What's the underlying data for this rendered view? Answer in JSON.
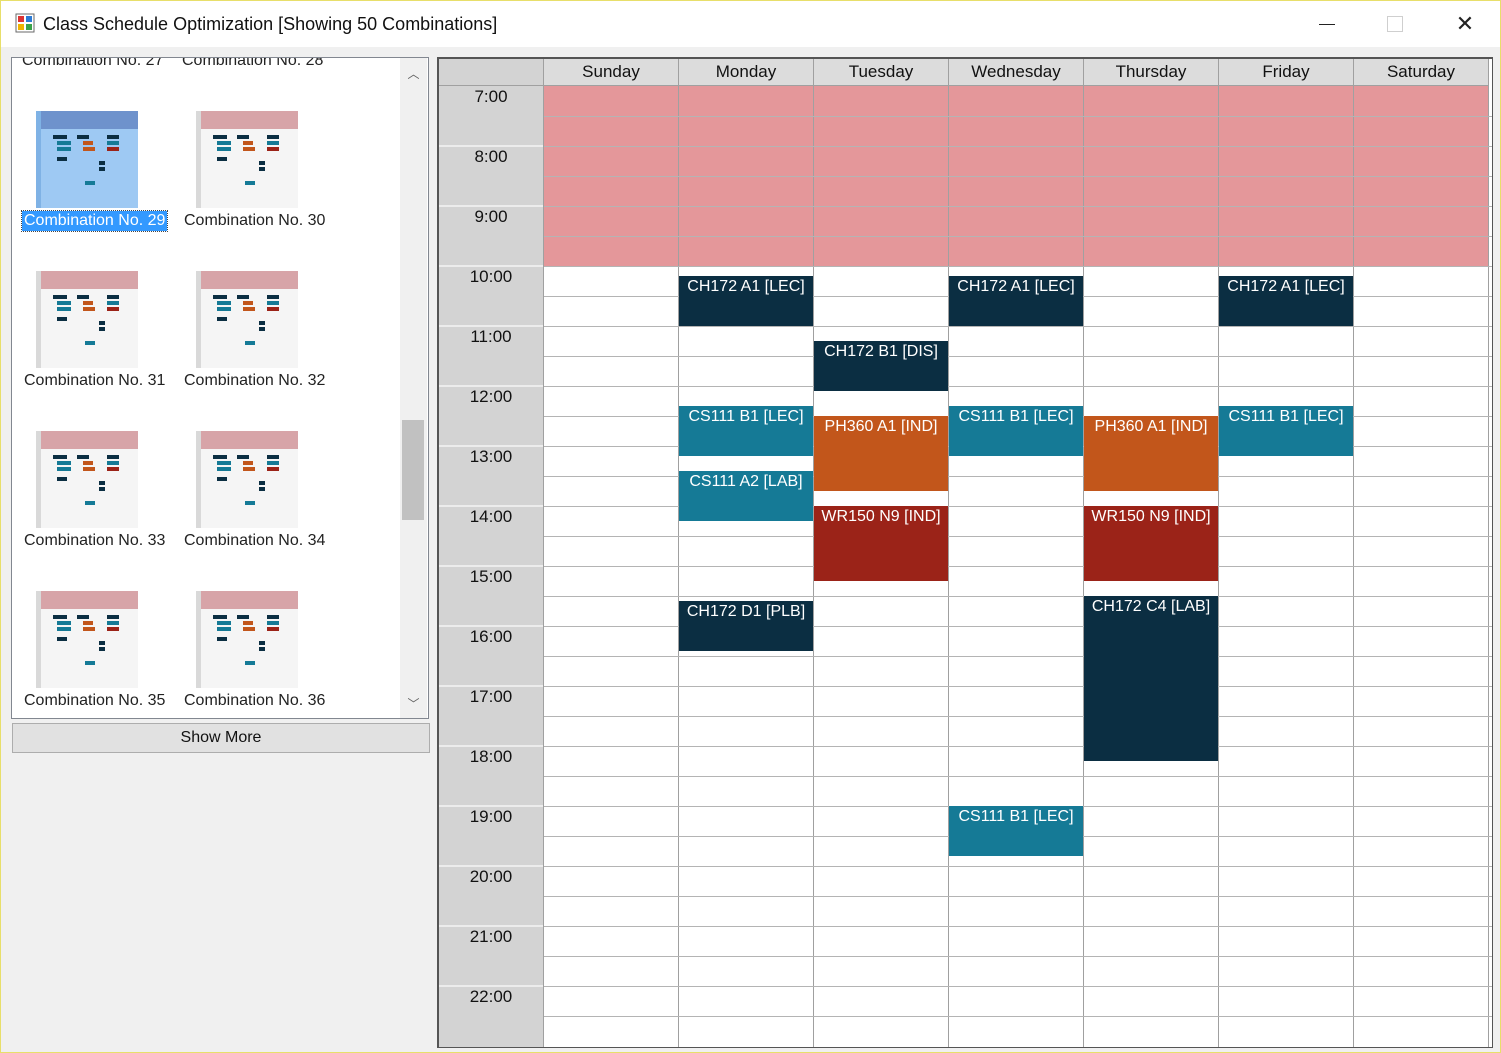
{
  "window": {
    "title": "Class Schedule Optimization [Showing 50 Combinations]",
    "controls": [
      "minimize",
      "maximize",
      "close"
    ],
    "close_glyph": "✕"
  },
  "combination_list": {
    "partial_top": [
      "Combination No. 27",
      "Combination No. 28"
    ],
    "items": [
      {
        "label": "Combination No. 29",
        "selected": true
      },
      {
        "label": "Combination No. 30",
        "selected": false
      },
      {
        "label": "Combination No. 31",
        "selected": false
      },
      {
        "label": "Combination No. 32",
        "selected": false
      },
      {
        "label": "Combination No. 33",
        "selected": false
      },
      {
        "label": "Combination No. 34",
        "selected": false
      },
      {
        "label": "Combination No. 35",
        "selected": false
      },
      {
        "label": "Combination No. 36",
        "selected": false
      }
    ],
    "scroll_up_glyph": "︿",
    "scroll_down_glyph": "﹀"
  },
  "show_more_label": "Show More",
  "schedule": {
    "days": [
      "Sunday",
      "Monday",
      "Tuesday",
      "Wednesday",
      "Thursday",
      "Friday",
      "Saturday"
    ],
    "hours": [
      "7:00",
      "8:00",
      "9:00",
      "10:00",
      "11:00",
      "12:00",
      "13:00",
      "14:00",
      "15:00",
      "16:00",
      "17:00",
      "18:00",
      "19:00",
      "20:00",
      "21:00",
      "22:00"
    ],
    "blocked_color": "#e4979a",
    "colors": {
      "LEC": "#0b2e42",
      "LEC_CS": "#157a96",
      "IND_PH": "#c2561b",
      "IND_WR": "#9b2318"
    },
    "events": [
      {
        "label": "CH172 A1 [LEC]",
        "day": 1,
        "start": "10:10",
        "end": "11:00",
        "color": "#0b2e42"
      },
      {
        "label": "CH172 A1 [LEC]",
        "day": 3,
        "start": "10:10",
        "end": "11:00",
        "color": "#0b2e42"
      },
      {
        "label": "CH172 A1 [LEC]",
        "day": 5,
        "start": "10:10",
        "end": "11:00",
        "color": "#0b2e42"
      },
      {
        "label": "CH172 B1 [DIS]",
        "day": 2,
        "start": "11:15",
        "end": "12:05",
        "color": "#0b2e42"
      },
      {
        "label": "CS111 B1 [LEC]",
        "day": 1,
        "start": "12:20",
        "end": "13:10",
        "color": "#157a96"
      },
      {
        "label": "CS111 B1 [LEC]",
        "day": 3,
        "start": "12:20",
        "end": "13:10",
        "color": "#157a96"
      },
      {
        "label": "CS111 B1 [LEC]",
        "day": 5,
        "start": "12:20",
        "end": "13:10",
        "color": "#157a96"
      },
      {
        "label": "PH360 A1 [IND]",
        "day": 2,
        "start": "12:30",
        "end": "13:45",
        "color": "#c2561b"
      },
      {
        "label": "PH360 A1 [IND]",
        "day": 4,
        "start": "12:30",
        "end": "13:45",
        "color": "#c2561b"
      },
      {
        "label": "CS111 A2 [LAB]",
        "day": 1,
        "start": "13:25",
        "end": "14:15",
        "color": "#157a96"
      },
      {
        "label": "WR150 N9 [IND]",
        "day": 2,
        "start": "14:00",
        "end": "15:15",
        "color": "#9b2318"
      },
      {
        "label": "WR150 N9 [IND]",
        "day": 4,
        "start": "14:00",
        "end": "15:15",
        "color": "#9b2318"
      },
      {
        "label": "CH172 D1 [PLB]",
        "day": 1,
        "start": "15:35",
        "end": "16:25",
        "color": "#0b2e42"
      },
      {
        "label": "CH172 C4 [LAB]",
        "day": 4,
        "start": "15:30",
        "end": "18:15",
        "color": "#0b2e42"
      },
      {
        "label": "CS111 B1 [LEC]",
        "day": 3,
        "start": "19:00",
        "end": "19:50",
        "color": "#157a96"
      }
    ]
  }
}
